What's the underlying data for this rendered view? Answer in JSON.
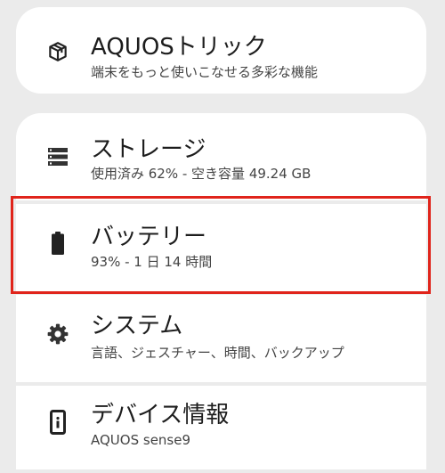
{
  "aquos_trick": {
    "icon": "cube-icon",
    "title": "AQUOSトリック",
    "subtitle": "端末をもっと使いこなせる多彩な機能"
  },
  "storage": {
    "icon": "storage-icon",
    "title": "ストレージ",
    "subtitle": "使用済み 62% - 空き容量 49.24 GB"
  },
  "battery": {
    "icon": "battery-icon",
    "title": "バッテリー",
    "subtitle": "93% - 1 日 14 時間",
    "highlight_color": "#e0241b"
  },
  "system": {
    "icon": "gear-icon",
    "title": "システム",
    "subtitle": "言語、ジェスチャー、時間、バックアップ"
  },
  "device_info": {
    "icon": "phone-info-icon",
    "title": "デバイス情報",
    "subtitle": "AQUOS sense9"
  }
}
